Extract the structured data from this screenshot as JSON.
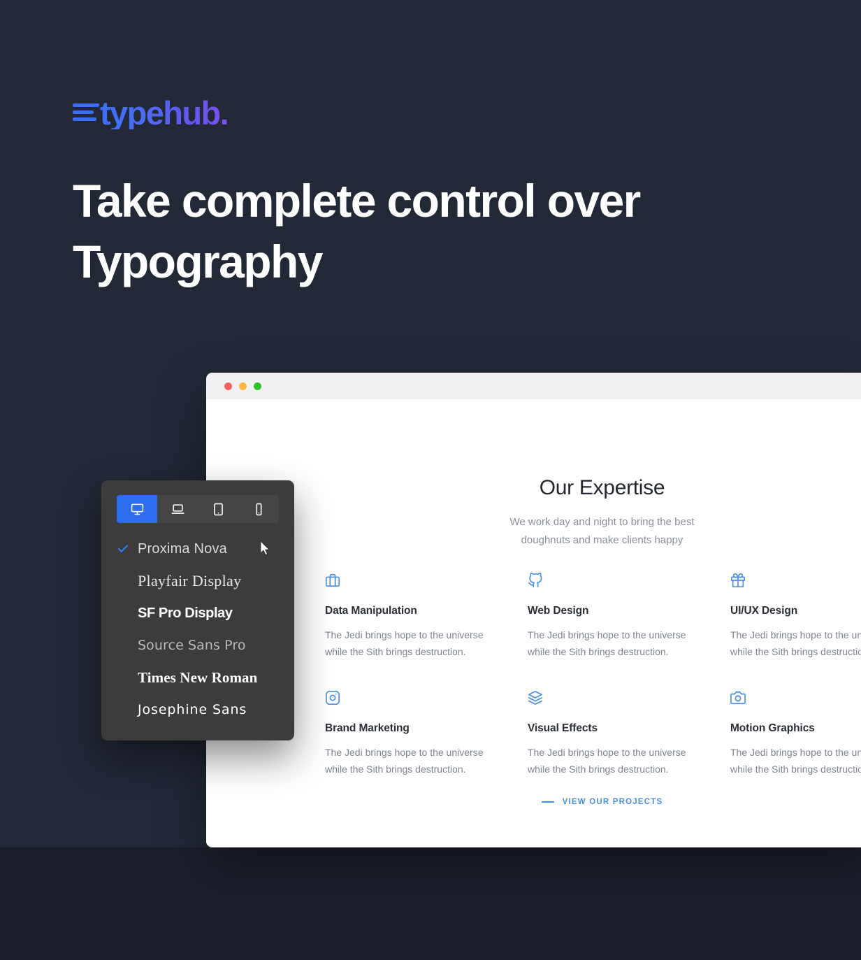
{
  "brand": {
    "name": "typehub.",
    "logo_icon": "three-bars-icon",
    "gradient_start": "#3c6ef6",
    "gradient_end": "#7b4fee"
  },
  "hero": {
    "line1": "Take complete control over",
    "line2": "Typography"
  },
  "theme": {
    "background": "#222836",
    "background_bottom": "#1b1f2a",
    "accent_blue": "#2f6df0",
    "card_icon_blue": "#4a90e2",
    "panel_bg": "#3c3c3c"
  },
  "browser": {
    "traffic_lights": [
      {
        "name": "close",
        "color": "#fb5f62"
      },
      {
        "name": "minimize",
        "color": "#fbb540"
      },
      {
        "name": "maximize",
        "color": "#2fc22f"
      }
    ],
    "page": {
      "section_title": "Our Expertise",
      "section_sub_line1": "We work day and night to bring the best",
      "section_sub_line2": "doughnuts and make clients happy",
      "cards": [
        {
          "icon": "briefcase-icon",
          "title": "Data Manipulation",
          "text_line1": "The Jedi brings hope to the universe",
          "text_line2": "while the Sith brings destruction."
        },
        {
          "icon": "github-icon",
          "title": "Web Design",
          "text_line1": "The Jedi brings hope to the universe",
          "text_line2": "while the Sith brings destruction."
        },
        {
          "icon": "gift-icon",
          "title": "UI/UX Design",
          "text_line1": "The Jedi brings hope to the universe",
          "text_line2": "while the Sith brings destruction."
        },
        {
          "icon": "instagram-icon",
          "title": "Brand Marketing",
          "text_line1": "The Jedi brings hope to the universe",
          "text_line2": "while the Sith brings destruction."
        },
        {
          "icon": "layers-icon",
          "title": "Visual Effects",
          "text_line1": "The Jedi brings hope to the universe",
          "text_line2": "while the Sith brings destruction."
        },
        {
          "icon": "camera-icon",
          "title": "Motion Graphics",
          "text_line1": "The Jedi brings hope to the universe",
          "text_line2": "while the Sith brings destruction."
        }
      ],
      "cta_label": "VIEW OUR PROJECTS"
    }
  },
  "font_panel": {
    "devices": [
      {
        "icon": "desktop-icon",
        "label": "Desktop",
        "active": true
      },
      {
        "icon": "laptop-icon",
        "label": "Laptop",
        "active": false
      },
      {
        "icon": "tablet-icon",
        "label": "Tablet",
        "active": false
      },
      {
        "icon": "mobile-icon",
        "label": "Mobile",
        "active": false
      }
    ],
    "fonts": [
      {
        "name": "Proxima Nova",
        "selected": true
      },
      {
        "name": "Playfair Display",
        "selected": false
      },
      {
        "name": "SF Pro Display",
        "selected": false
      },
      {
        "name": "Source Sans Pro",
        "selected": false
      },
      {
        "name": "Times New Roman",
        "selected": false
      },
      {
        "name": "Josephine Sans",
        "selected": false
      }
    ],
    "check_icon": "checkmark-icon"
  },
  "cursor": {
    "icon": "mouse-pointer-icon"
  }
}
